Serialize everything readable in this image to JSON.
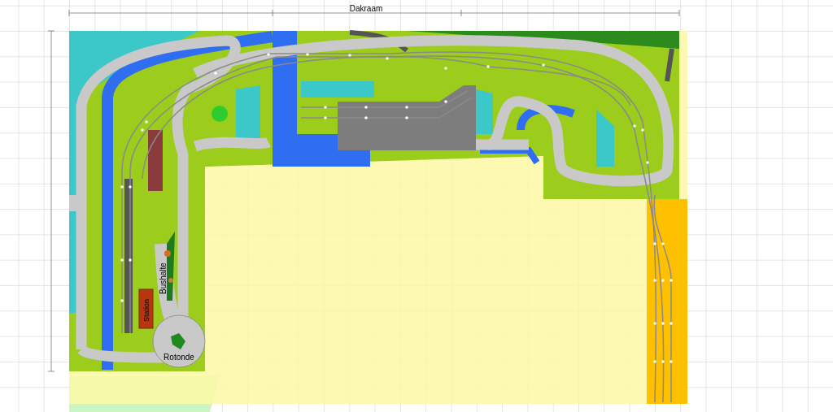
{
  "dimension_label": "Dakraam",
  "labels": [
    {
      "kind": "bus-stop",
      "text": "Bushalte"
    },
    {
      "kind": "building",
      "text": "Station"
    },
    {
      "kind": "roundabout",
      "text": "Rotonde"
    }
  ]
}
